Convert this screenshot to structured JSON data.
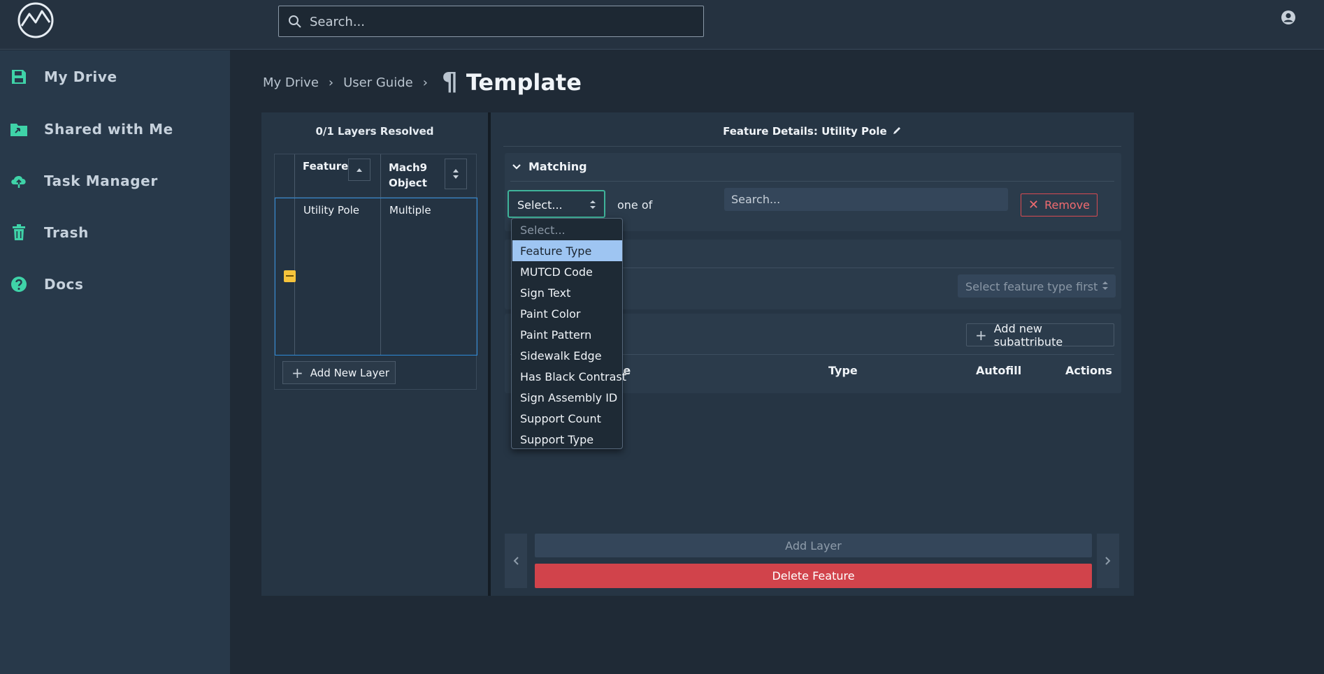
{
  "header": {
    "search_placeholder": "Search..."
  },
  "sidebar": {
    "accent_color": "#3fd3a8",
    "items": [
      {
        "label": "My Drive",
        "icon": "floppy-disk-icon"
      },
      {
        "label": "Shared with Me",
        "icon": "shared-folder-icon"
      },
      {
        "label": "Task Manager",
        "icon": "cloud-upload-icon"
      },
      {
        "label": "Trash",
        "icon": "trash-icon"
      },
      {
        "label": "Docs",
        "icon": "question-circle-icon"
      }
    ]
  },
  "breadcrumb": {
    "items": [
      "My Drive",
      "User Guide"
    ],
    "current": "Template",
    "icon": "pilcrow-icon"
  },
  "layers_panel": {
    "title": "0/1 Layers Resolved",
    "columns": [
      "Feature",
      "Mach9 Object"
    ],
    "rows": [
      {
        "feature": "Utility Pole",
        "object": "Multiple",
        "status_color": "#f5c33b"
      }
    ],
    "add_button": "Add New Layer"
  },
  "feature_panel": {
    "title_prefix": "Feature Details:",
    "title_name": "Utility Pole",
    "matching": {
      "label": "Matching",
      "select_value": "Select...",
      "connector": "one of",
      "search_placeholder": "Search...",
      "remove_label": "Remove"
    },
    "feature_type_placeholder": "Select feature type first",
    "subattributes": {
      "add_label": "Add new subattribute",
      "columns": [
        "ne",
        "Type",
        "Autofill",
        "Actions"
      ]
    },
    "add_layer_label": "Add Layer",
    "delete_label": "Delete Feature",
    "delete_color": "#d1434b"
  },
  "dropdown": {
    "options": [
      "Select...",
      "Feature Type",
      "MUTCD Code",
      "Sign Text",
      "Paint Color",
      "Paint Pattern",
      "Sidewalk Edge",
      "Has Black Contrast",
      "Sign Assembly ID",
      "Support Count",
      "Support Type"
    ],
    "highlighted": "Feature Type",
    "highlight_color": "#9ec5f2"
  }
}
